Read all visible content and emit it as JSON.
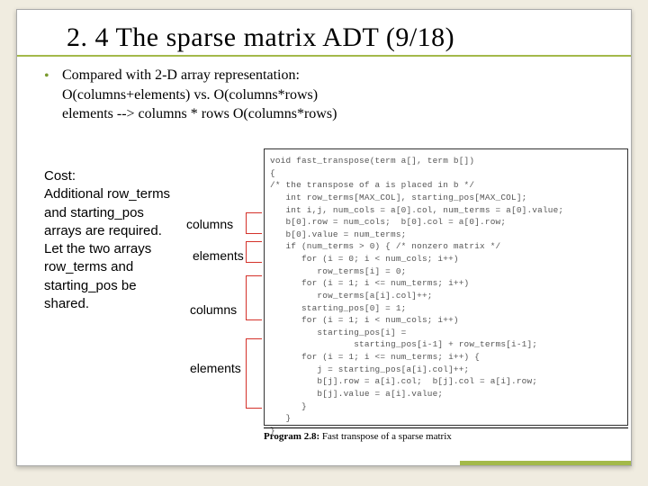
{
  "title": "2. 4 The sparse matrix ADT (9/18)",
  "bullet_lines": {
    "l1": "Compared with 2-D array representation:",
    "l2": "O(columns+elements) vs. O(columns*rows)",
    "l3": "elements --> columns * rows O(columns*rows)"
  },
  "cost_block": {
    "l1": "Cost:",
    "l2": "Additional row_terms",
    "l3": "and starting_pos",
    "l4": "arrays are required.",
    "l5": "Let the two arrays",
    "l6": "row_terms and",
    "l7": "starting_pos be",
    "l8": "shared."
  },
  "labels": {
    "columns1": "columns",
    "elements1": "elements",
    "columns2": "columns",
    "elements2": "elements"
  },
  "code": "void fast_transpose(term a[], term b[])\n{\n/* the transpose of a is placed in b */\n   int row_terms[MAX_COL], starting_pos[MAX_COL];\n   int i,j, num_cols = a[0].col, num_terms = a[0].value;\n   b[0].row = num_cols;  b[0].col = a[0].row;\n   b[0].value = num_terms;\n   if (num_terms > 0) { /* nonzero matrix */\n      for (i = 0; i < num_cols; i++)\n         row_terms[i] = 0;\n      for (i = 1; i <= num_terms; i++)\n         row_terms[a[i].col]++;\n      starting_pos[0] = 1;\n      for (i = 1; i < num_cols; i++)\n         starting_pos[i] =\n                starting_pos[i-1] + row_terms[i-1];\n      for (i = 1; i <= num_terms; i++) {\n         j = starting_pos[a[i].col]++;\n         b[j].row = a[i].col;  b[j].col = a[i].row;\n         b[j].value = a[i].value;\n      }\n   }\n}",
  "caption_bold": "Program 2.8:",
  "caption_rest": " Fast transpose of a sparse matrix"
}
